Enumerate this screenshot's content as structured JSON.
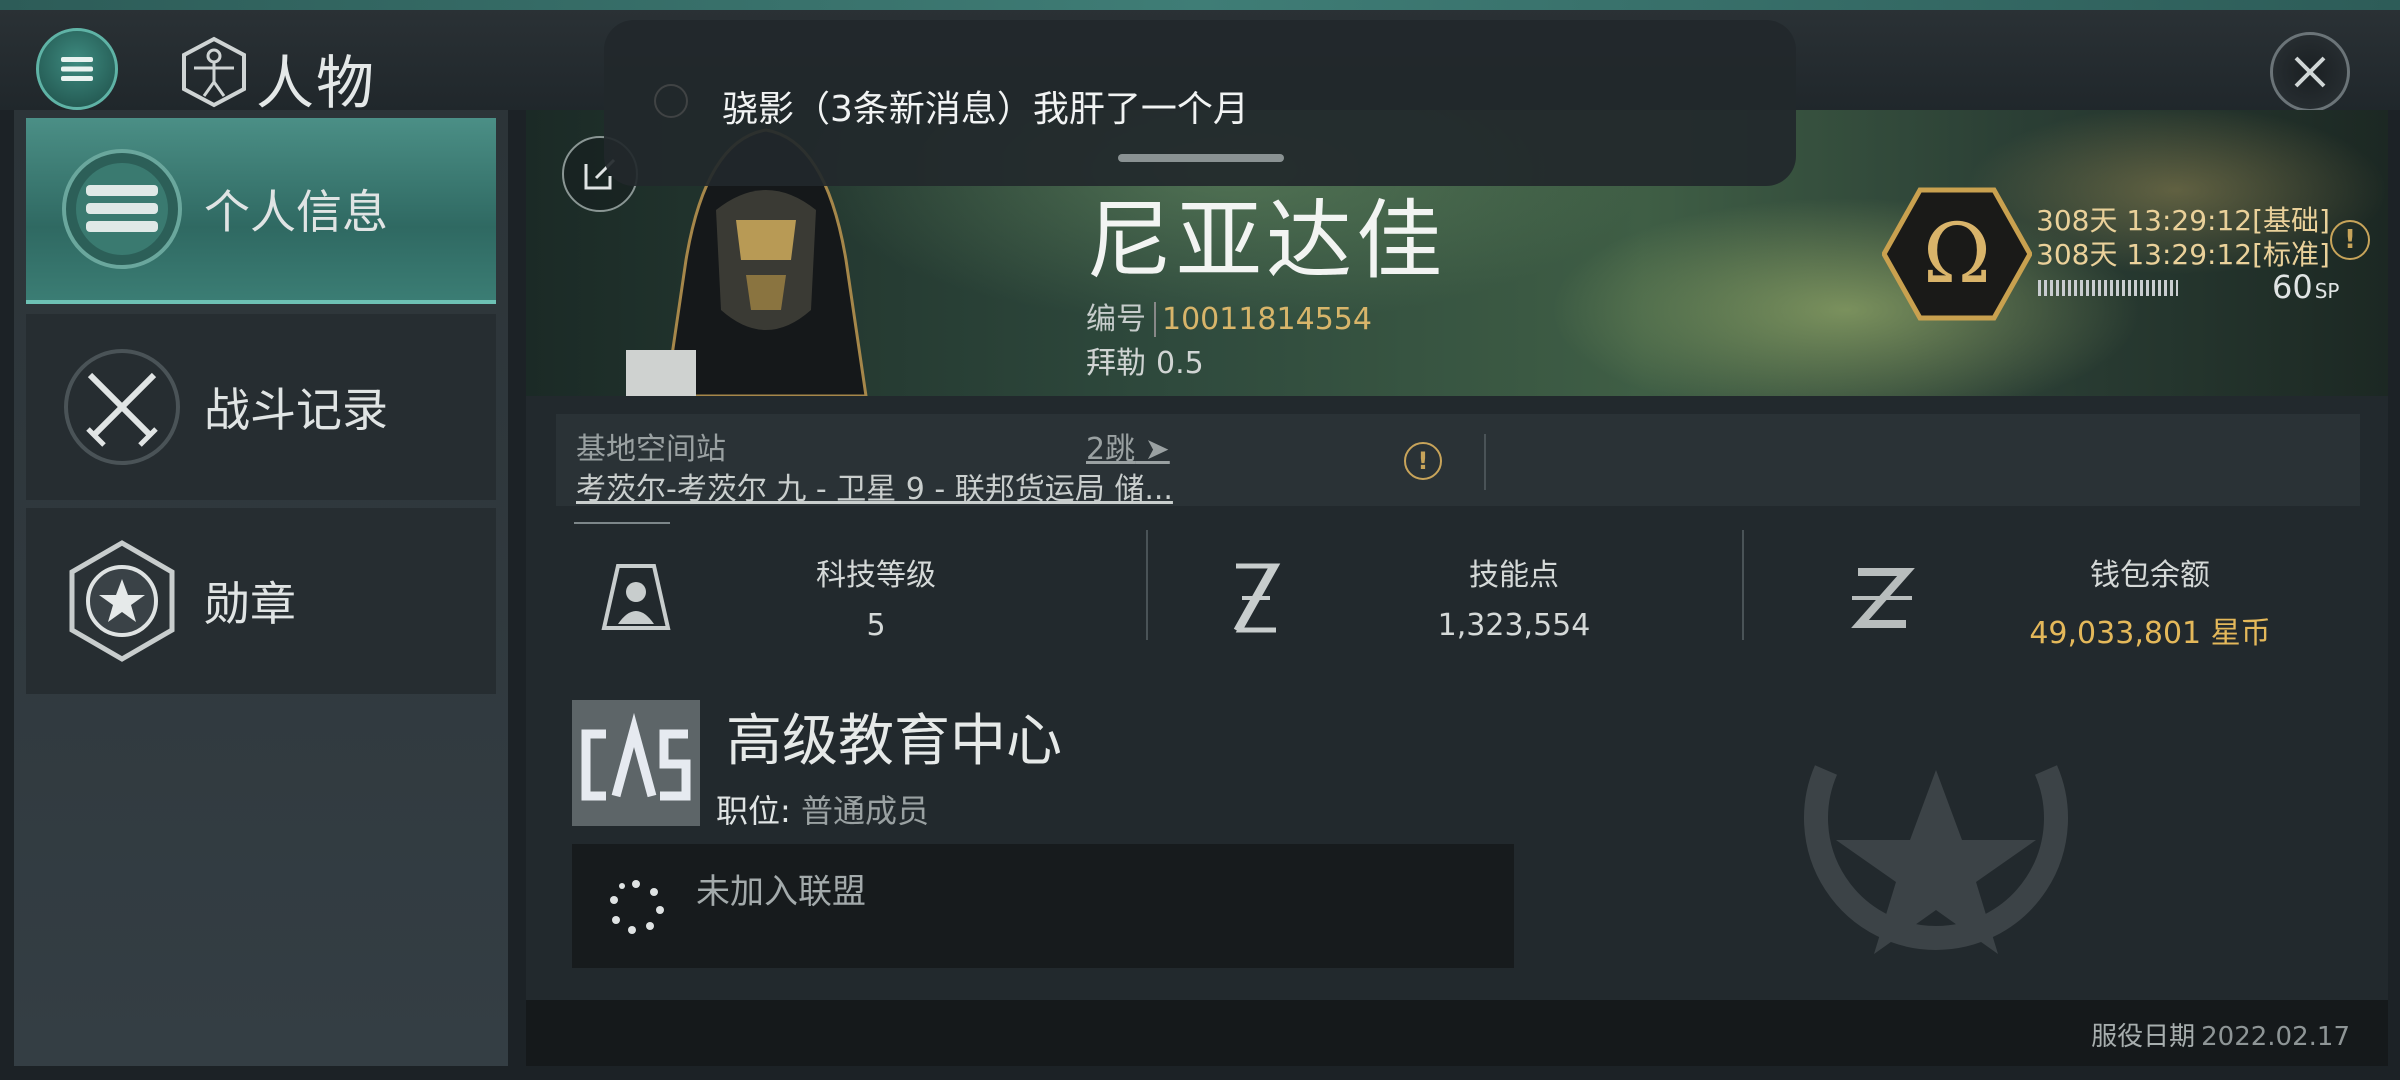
{
  "header": {
    "title": "人物"
  },
  "notification": {
    "text": "骁影（3条新消息）我肝了一个月"
  },
  "sidebar": {
    "items": [
      {
        "label": "个人信息",
        "icon": "list-icon",
        "active": true
      },
      {
        "label": "战斗记录",
        "icon": "crossed-swords-icon",
        "active": false
      },
      {
        "label": "勋章",
        "icon": "star-medal-icon",
        "active": false
      }
    ]
  },
  "profile": {
    "name": "尼亚达佳",
    "id_label": "编号",
    "id_value": "10011814554",
    "security_label": "拜勒",
    "security_value": "0.5"
  },
  "omega": {
    "line1": "308天 13:29:12[基础]",
    "line2": "308天 13:29:12[标准]",
    "sp_value": "60",
    "sp_unit": "SP"
  },
  "station": {
    "label": "基地空间站",
    "jumps": "2跳",
    "name": "考茨尔-考茨尔 九 - 卫星 9 - 联邦货运局 储..."
  },
  "stats": {
    "tech_label": "科技等级",
    "tech_value": "5",
    "skill_label": "技能点",
    "skill_value": "1,323,554",
    "wallet_label": "钱包余额",
    "wallet_value": "49,033,801 星币"
  },
  "corporation": {
    "name": "高级教育中心",
    "role_label": "职位",
    "role_value": "普通成员",
    "alliance": "未加入联盟"
  },
  "footer": {
    "service_label": "服役日期",
    "service_date": "2022.02.17"
  },
  "colors": {
    "accent": "#4b8f86",
    "gold": "#e4b85a",
    "background": "#1c2226"
  }
}
